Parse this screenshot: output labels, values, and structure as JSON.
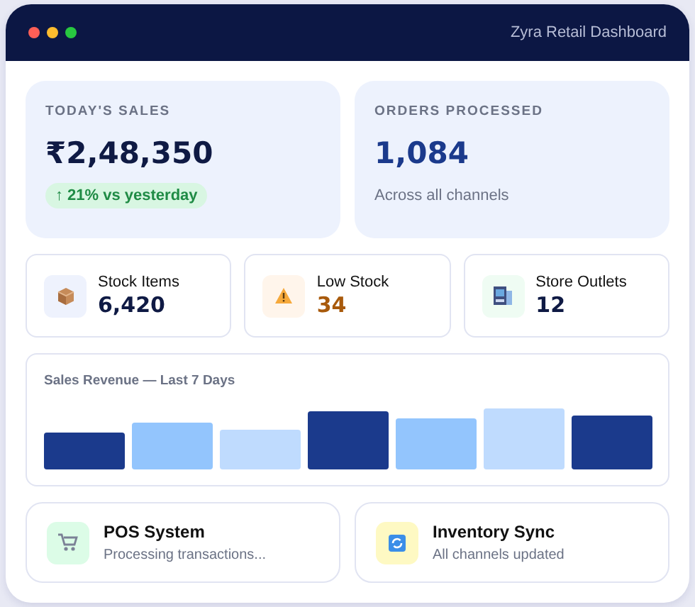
{
  "window": {
    "title": "Zyra Retail Dashboard"
  },
  "summary": [
    {
      "label": "TODAY'S SALES",
      "value": "₹2,48,350",
      "badge": "↑ 21% vs yesterday"
    },
    {
      "label": "ORDERS PROCESSED",
      "value": "1,084",
      "note": "Across all channels"
    }
  ],
  "stats": [
    {
      "label": "Stock Items",
      "value": "6,420",
      "alert": false
    },
    {
      "label": "Low Stock",
      "value": "34",
      "alert": true
    },
    {
      "label": "Store Outlets",
      "value": "12",
      "alert": false
    }
  ],
  "chart": {
    "title": "Sales Revenue — Last 7 Days"
  },
  "services": [
    {
      "name": "POS System",
      "status": "Processing transactions..."
    },
    {
      "name": "Inventory Sync",
      "status": "All channels updated"
    }
  ]
}
